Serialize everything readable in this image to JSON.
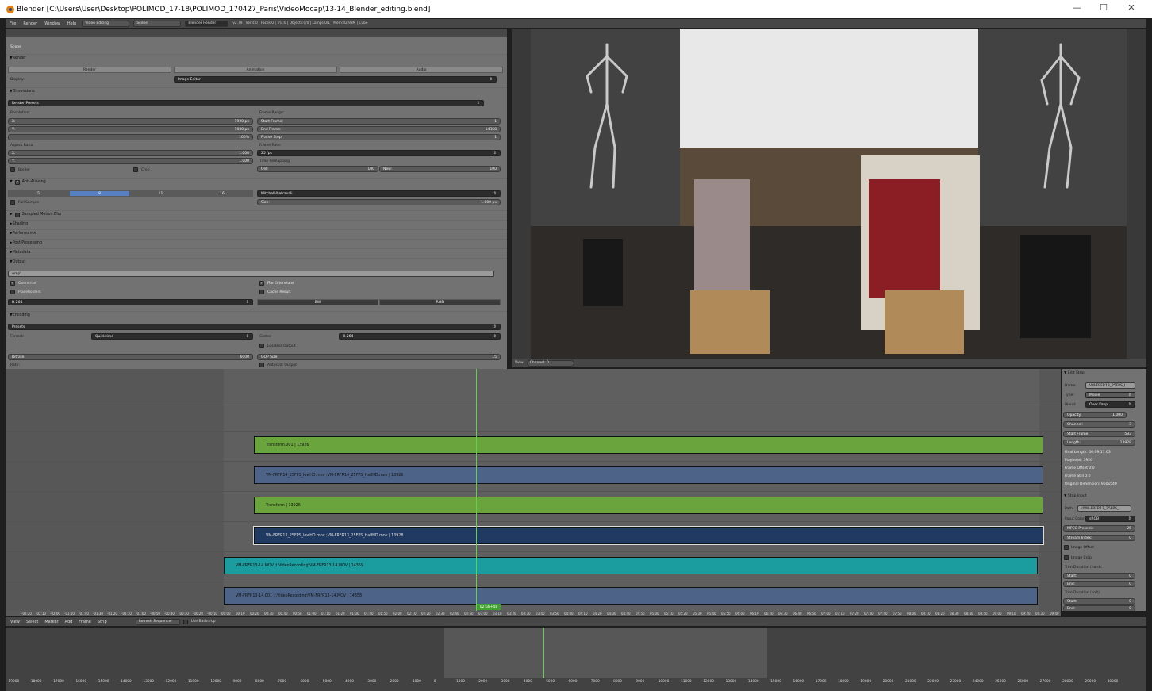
{
  "window": {
    "title": "Blender [C:\\Users\\User\\Desktop\\POLIMOD_17-18\\POLIMOD_170427_Paris\\VideoMocap\\13-14_Blender_editing.blend]"
  },
  "topbar": {
    "menus": [
      "File",
      "Render",
      "Window",
      "Help"
    ],
    "layout": "Video Editing",
    "scene": "Scene",
    "engine": "Blender Render",
    "stats": "v2.79 | Verts:0 | Faces:0 | Tris:0 | Objects:0/0 | Lamps:0/1 | Mem:82.98M | Cube"
  },
  "props": {
    "scene_label": "Scene",
    "render": {
      "header": "Render",
      "buttons": [
        "Render",
        "Animation",
        "Audio"
      ],
      "display_label": "Display:",
      "display_value": "Image Editor"
    },
    "dimensions": {
      "header": "Dimensions",
      "presets": "Render Presets",
      "resolution_label": "Resolution:",
      "res_x_label": "X:",
      "res_x": "1920 px",
      "res_y_label": "Y:",
      "res_y": "1080 px",
      "res_pct": "100%",
      "aspect_label": "Aspect Ratio:",
      "aspect_x_label": "X:",
      "aspect_x": "1.000",
      "aspect_y_label": "Y:",
      "aspect_y": "1.000",
      "border": "Border",
      "crop": "Crop",
      "frame_range_label": "Frame Range:",
      "start_label": "Start Frame:",
      "start": "1",
      "end_label": "End Frame:",
      "end": "14358",
      "step_label": "Frame Step:",
      "step": "1",
      "frame_rate_label": "Frame Rate:",
      "frame_rate": "25 fps",
      "remap_label": "Time Remapping:",
      "old_label": "Old:",
      "old": "100",
      "new_label": "New:",
      "new": "100"
    },
    "aa": {
      "header": "Anti-Aliasing",
      "samples": [
        "5",
        "8",
        "11",
        "16"
      ],
      "filter": "Mitchell-Netravali",
      "full_sample": "Full Sample",
      "size_label": "Size:",
      "size": "1.000 px"
    },
    "collapsed": [
      "Sampled Motion Blur",
      "Shading",
      "Performance",
      "Post Processing",
      "Metadata"
    ],
    "output": {
      "header": "Output",
      "path": "Amp\\",
      "overwrite": "Overwrite",
      "placeholders": "Placeholders",
      "file_ext": "File Extensions",
      "cache": "Cache Result",
      "format": "H.264",
      "bw": "BW",
      "rgb": "RGB"
    },
    "encoding": {
      "header": "Encoding",
      "presets": "Presets",
      "format_label": "Format:",
      "format": "Quicktime",
      "codec_label": "Codec:",
      "codec": "H.264",
      "lossless": "Lossless Output",
      "bitrate_label": "Bitrate:",
      "bitrate": "6000",
      "gop_label": "GOP Size:",
      "gop": "15",
      "rate_label": "Rate:",
      "autosplit": "Autosplit Output"
    }
  },
  "preview_bar": {
    "view": "View",
    "channel_label": "Channel:",
    "channel": "0"
  },
  "strips": [
    {
      "label": "Transform.001 | 13926",
      "color": "#6aa43c"
    },
    {
      "label": "VM-FRFR14_25FPS_lowHD.mov ;VM-FRFR14_25FPS_HalfHD.mov | 13926",
      "color": "#4d6488"
    },
    {
      "label": "Transform | 13926",
      "color": "#6aa43c"
    },
    {
      "label": "VM-FRFR13_25FPS_lowHD.mov ;VM-FRFR13_25FPS_HalfHD.mov | 13928",
      "color": "#213a62"
    },
    {
      "label": "VM-FRFR13-14.MOV ;I:VideoRecording\\VM-FRFR13-14.MOV | 14359",
      "color": "#1b9da0"
    },
    {
      "label": "VM-FRFR13-14.001 ;I:VideoRecording\\VM-FRFR13-14.MOV | 14358",
      "color": "#4d6488"
    }
  ],
  "playhead": "02:58+08",
  "ruler_labels": [
    "-02:20",
    "-02:10",
    "-02:00",
    "-01:50",
    "-01:40",
    "-01:30",
    "-01:20",
    "-01:10",
    "-01:00",
    "-00:50",
    "-00:40",
    "-00:30",
    "-00:20",
    "-00:10",
    "00:00",
    "00:10",
    "00:20",
    "00:30",
    "00:40",
    "00:50",
    "01:00",
    "01:10",
    "01:20",
    "01:30",
    "01:40",
    "01:50",
    "02:00",
    "02:10",
    "02:20",
    "02:30",
    "02:40",
    "02:50",
    "03:00",
    "03:10",
    "03:20",
    "03:30",
    "03:40",
    "03:50",
    "04:00",
    "04:10",
    "04:20",
    "04:30",
    "04:40",
    "04:50",
    "05:00",
    "05:10",
    "05:20",
    "05:30",
    "05:40",
    "05:50",
    "06:00",
    "06:10",
    "06:20",
    "06:30",
    "06:40",
    "06:50",
    "07:00",
    "07:10",
    "07:20",
    "07:30",
    "07:40",
    "07:50",
    "08:00",
    "08:10",
    "08:20",
    "08:30",
    "08:40",
    "08:50",
    "09:00",
    "09:10",
    "09:20",
    "09:30",
    "09:40"
  ],
  "seq_bar": {
    "menus": [
      "View",
      "Select",
      "Marker",
      "Add",
      "Frame",
      "Strip"
    ],
    "refresh": "Refresh Sequencer",
    "backdrop": "Use Backdrop"
  },
  "side": {
    "edit_header": "Edit Strip",
    "name_label": "Name:",
    "name": "VM-FRFR13_25FPS_l",
    "type_label": "Type:",
    "type": "Movie",
    "blend_label": "Blend:",
    "blend": "Over Drop",
    "opacity_label": "Opacity:",
    "opacity": "1.000",
    "channel_label": "Channel:",
    "channel": "3",
    "start_label": "Start Frame:",
    "start": "533",
    "length_label": "Length:",
    "length": "13928",
    "info": [
      "Final Length: 00:09:17:03",
      "Playhead: 3926",
      "Frame Offset 0:0",
      "Frame Still 0:0",
      "Original Dimension: 960x540"
    ],
    "input_header": "Strip Input",
    "path_label": "Path:",
    "path": "//VM-FRFR13_25FPS_",
    "color_label": "Input Color:",
    "color": "sRGB",
    "mpeg_label": "MPEG Preseek:",
    "mpeg": "25",
    "stream_label": "Stream Index:",
    "stream": "0",
    "img_offset": "Image Offset",
    "img_crop": "Image Crop",
    "trim_hard": "Trim Duration (hard):",
    "trim_soft": "Trim Duration (soft):",
    "start2_label": "Start:",
    "start2": "0",
    "end2_label": "End:",
    "end2": "0",
    "start3": "0",
    "end3": "0"
  },
  "timeline_labels": [
    "-19000",
    "-18000",
    "-17000",
    "-16000",
    "-15000",
    "-14000",
    "-13000",
    "-12000",
    "-11000",
    "-10000",
    "-9000",
    "-8000",
    "-7000",
    "-6000",
    "-5000",
    "-4000",
    "-3000",
    "-2000",
    "-1000",
    "0",
    "1000",
    "2000",
    "3000",
    "4000",
    "5000",
    "6000",
    "7000",
    "8000",
    "9000",
    "10000",
    "11000",
    "12000",
    "13000",
    "14000",
    "15000",
    "16000",
    "17000",
    "18000",
    "19000",
    "20000",
    "21000",
    "22000",
    "23000",
    "24000",
    "25000",
    "26000",
    "27000",
    "28000",
    "29000",
    "30000"
  ]
}
